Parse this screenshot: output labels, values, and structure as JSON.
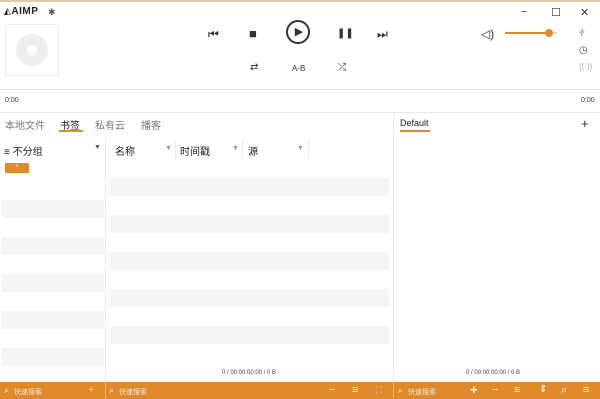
{
  "app": {
    "logo": "AIMP",
    "logo_mark": "◭"
  },
  "window": {
    "minimize": "−",
    "maximize": "☐",
    "close": "✕"
  },
  "player": {
    "prev": "⏮",
    "stop": "■",
    "play": "▶",
    "pause": "❚❚",
    "next": "⏭",
    "repeat": "⇄",
    "ab": "A-B",
    "shuffle": "⤮",
    "time_elapsed": "0:00",
    "time_total": "0:00",
    "volume": 0.85
  },
  "tabs": [
    {
      "label": "本地文件"
    },
    {
      "label": "书签"
    },
    {
      "label": "私有云"
    },
    {
      "label": "播客"
    }
  ],
  "left_panel": {
    "group_label": "不分组",
    "chip": "*"
  },
  "columns": [
    {
      "label": "名称"
    },
    {
      "label": "时间戳"
    },
    {
      "label": "源"
    }
  ],
  "playlist": {
    "tab": "Default"
  },
  "status": {
    "middle": "0 / 00:00:00:00 / 0 B",
    "right": "0 / 00:00:00:00 / 0 B"
  },
  "bottom": {
    "search1": "快速搜索",
    "search2": "快速搜索",
    "search3": "快速搜索"
  },
  "colors": {
    "accent": "#e08a2c"
  }
}
